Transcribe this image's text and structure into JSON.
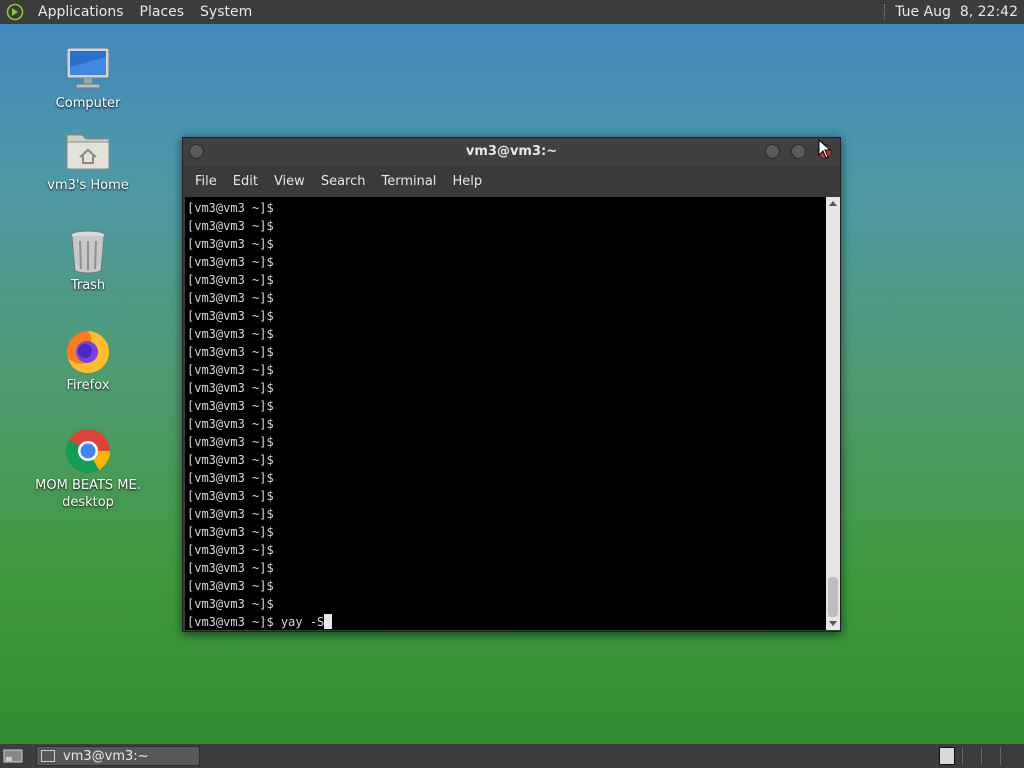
{
  "top_panel": {
    "menus": [
      "Applications",
      "Places",
      "System"
    ],
    "clock": "Tue Aug  8, 22:42"
  },
  "desktop_icons": [
    {
      "label": "Computer",
      "icon": "computer-icon"
    },
    {
      "label": "vm3's Home",
      "icon": "home-folder-icon"
    },
    {
      "label": "Trash",
      "icon": "trash-icon"
    },
    {
      "label": "Firefox",
      "icon": "firefox-icon"
    },
    {
      "label_line1": "MOM BEATS ME.",
      "label_line2": "desktop",
      "icon": "chrome-icon"
    }
  ],
  "terminal": {
    "title": "vm3@vm3:~",
    "menu": [
      "File",
      "Edit",
      "View",
      "Search",
      "Terminal",
      "Help"
    ],
    "prompt": "[vm3@vm3 ~]$",
    "empty_prompt_count": 23,
    "current_command": "yay -S"
  },
  "taskbar": {
    "task_label": "vm3@vm3:~"
  }
}
